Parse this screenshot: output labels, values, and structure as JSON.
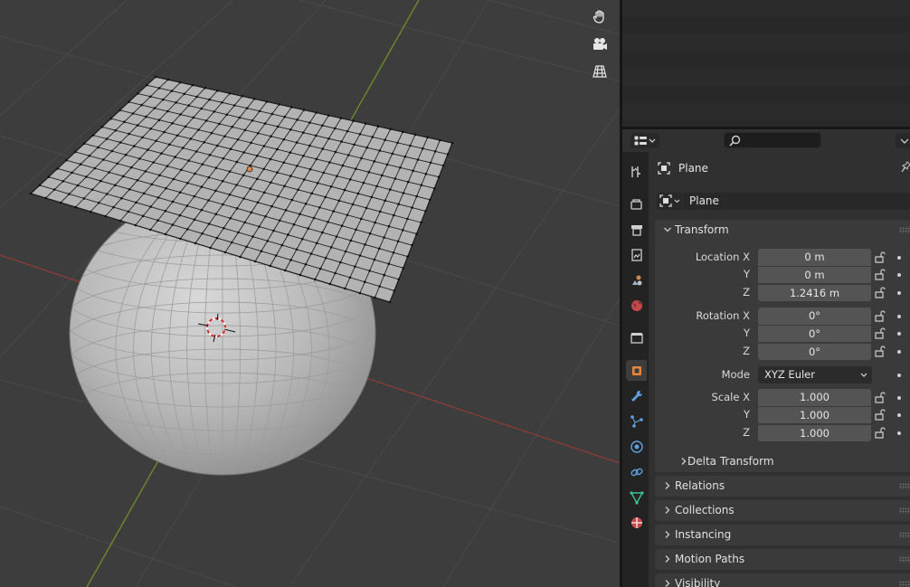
{
  "properties": {
    "object_name": "Plane",
    "data_name": "Plane",
    "transform": {
      "header": "Transform",
      "location_label": "Location X",
      "location": {
        "x": "0 m",
        "y": "0 m",
        "z": "1.2416 m"
      },
      "rotation_label": "Rotation X",
      "rotation": {
        "x": "0°",
        "y": "0°",
        "z": "0°"
      },
      "mode_label": "Mode",
      "mode_value": "XYZ Euler",
      "scale_label": "Scale X",
      "scale": {
        "x": "1.000",
        "y": "1.000",
        "z": "1.000"
      },
      "axis_y": "Y",
      "axis_z": "Z"
    },
    "delta_transform": "Delta Transform",
    "sections": [
      "Relations",
      "Collections",
      "Instancing",
      "Motion Paths",
      "Visibility"
    ]
  },
  "viewport_tools": [
    "hand-pan-icon",
    "camera-view-icon",
    "perspective-grid-icon"
  ],
  "property_tabs": [
    "tool-icon",
    "render-icon",
    "output-icon",
    "view-layer-icon",
    "scene-icon",
    "world-icon",
    "collection-icon",
    "object-icon",
    "modifier-icon",
    "particles-icon",
    "physics-icon",
    "constraints-icon",
    "object-data-icon",
    "material-icon"
  ],
  "colors": {
    "viewport_bg": "#3d3d3d",
    "panel_bg": "#303030",
    "field_bg": "#545454",
    "x_axis": "#8a3a3a",
    "y_axis": "#6a8a2a",
    "active_object": "#e8833a"
  }
}
